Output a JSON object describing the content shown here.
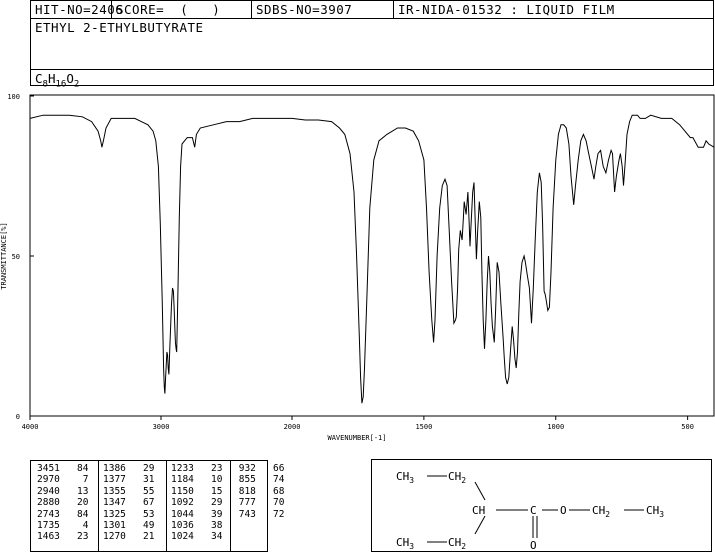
{
  "header": {
    "hit_no": "HIT-NO=2406",
    "score": "SCORE=  (   )",
    "sdbs_no": "SDBS-NO=3907",
    "ir_info": "IR-NIDA-01532 : LIQUID FILM",
    "compound_name": "ETHYL 2-ETHYLBUTYRATE",
    "formula_parts": [
      "C",
      "8",
      "H",
      "16",
      "O",
      "2"
    ]
  },
  "chart_data": {
    "type": "line",
    "xlabel": "WAVENUMBER[-1]",
    "ylabel": "TRANSMITTANCE[%]",
    "xlim": [
      4000,
      400
    ],
    "ylim": [
      0,
      100
    ],
    "x_ticks": [
      4000,
      3000,
      2000,
      1500,
      1000,
      500
    ],
    "y_ticks": [
      0,
      50,
      100
    ],
    "grid": false,
    "series": [
      {
        "points": [
          [
            4000,
            93
          ],
          [
            3900,
            94
          ],
          [
            3800,
            94
          ],
          [
            3700,
            94
          ],
          [
            3600,
            93.5
          ],
          [
            3530,
            92
          ],
          [
            3480,
            89
          ],
          [
            3460,
            86
          ],
          [
            3451,
            84
          ],
          [
            3440,
            86
          ],
          [
            3420,
            90
          ],
          [
            3380,
            93
          ],
          [
            3300,
            93
          ],
          [
            3200,
            93
          ],
          [
            3150,
            92
          ],
          [
            3100,
            91
          ],
          [
            3060,
            89
          ],
          [
            3040,
            86
          ],
          [
            3020,
            78
          ],
          [
            3005,
            60
          ],
          [
            2990,
            35
          ],
          [
            2980,
            15
          ],
          [
            2975,
            9
          ],
          [
            2970,
            7
          ],
          [
            2965,
            12
          ],
          [
            2955,
            20
          ],
          [
            2950,
            19
          ],
          [
            2945,
            15
          ],
          [
            2940,
            13
          ],
          [
            2932,
            22
          ],
          [
            2920,
            35
          ],
          [
            2912,
            40
          ],
          [
            2905,
            39
          ],
          [
            2900,
            34
          ],
          [
            2895,
            28
          ],
          [
            2890,
            23
          ],
          [
            2885,
            21
          ],
          [
            2880,
            20
          ],
          [
            2870,
            40
          ],
          [
            2860,
            62
          ],
          [
            2850,
            78
          ],
          [
            2840,
            85
          ],
          [
            2800,
            87
          ],
          [
            2760,
            87
          ],
          [
            2743,
            84
          ],
          [
            2730,
            88
          ],
          [
            2700,
            90
          ],
          [
            2600,
            91
          ],
          [
            2500,
            92
          ],
          [
            2400,
            92
          ],
          [
            2300,
            93
          ],
          [
            2200,
            93
          ],
          [
            2100,
            93
          ],
          [
            2000,
            93
          ],
          [
            1950,
            92.5
          ],
          [
            1900,
            92.5
          ],
          [
            1850,
            92
          ],
          [
            1820,
            90
          ],
          [
            1800,
            88
          ],
          [
            1780,
            82
          ],
          [
            1765,
            70
          ],
          [
            1755,
            50
          ],
          [
            1745,
            25
          ],
          [
            1740,
            12
          ],
          [
            1735,
            4
          ],
          [
            1730,
            6
          ],
          [
            1725,
            15
          ],
          [
            1715,
            40
          ],
          [
            1705,
            65
          ],
          [
            1690,
            80
          ],
          [
            1670,
            86
          ],
          [
            1640,
            88
          ],
          [
            1600,
            90
          ],
          [
            1570,
            90
          ],
          [
            1540,
            89
          ],
          [
            1520,
            86
          ],
          [
            1500,
            80
          ],
          [
            1490,
            65
          ],
          [
            1480,
            45
          ],
          [
            1470,
            30
          ],
          [
            1463,
            23
          ],
          [
            1458,
            30
          ],
          [
            1450,
            50
          ],
          [
            1440,
            65
          ],
          [
            1430,
            72
          ],
          [
            1420,
            74
          ],
          [
            1412,
            72
          ],
          [
            1405,
            60
          ],
          [
            1395,
            42
          ],
          [
            1386,
            29
          ],
          [
            1380,
            30
          ],
          [
            1377,
            31
          ],
          [
            1372,
            40
          ],
          [
            1368,
            52
          ],
          [
            1362,
            58
          ],
          [
            1355,
            55
          ],
          [
            1350,
            62
          ],
          [
            1347,
            67
          ],
          [
            1340,
            63
          ],
          [
            1333,
            70
          ],
          [
            1328,
            60
          ],
          [
            1325,
            53
          ],
          [
            1320,
            62
          ],
          [
            1315,
            70
          ],
          [
            1310,
            73
          ],
          [
            1305,
            60
          ],
          [
            1301,
            49
          ],
          [
            1296,
            58
          ],
          [
            1290,
            67
          ],
          [
            1284,
            62
          ],
          [
            1280,
            45
          ],
          [
            1275,
            30
          ],
          [
            1270,
            21
          ],
          [
            1265,
            30
          ],
          [
            1260,
            42
          ],
          [
            1255,
            50
          ],
          [
            1250,
            45
          ],
          [
            1245,
            35
          ],
          [
            1240,
            28
          ],
          [
            1233,
            23
          ],
          [
            1228,
            33
          ],
          [
            1222,
            48
          ],
          [
            1215,
            45
          ],
          [
            1208,
            35
          ],
          [
            1200,
            25
          ],
          [
            1195,
            18
          ],
          [
            1190,
            12
          ],
          [
            1184,
            10
          ],
          [
            1178,
            12
          ],
          [
            1172,
            20
          ],
          [
            1165,
            28
          ],
          [
            1160,
            24
          ],
          [
            1155,
            18
          ],
          [
            1150,
            15
          ],
          [
            1145,
            20
          ],
          [
            1140,
            32
          ],
          [
            1135,
            42
          ],
          [
            1128,
            48
          ],
          [
            1120,
            50
          ],
          [
            1115,
            48
          ],
          [
            1108,
            44
          ],
          [
            1100,
            40
          ],
          [
            1092,
            29
          ],
          [
            1085,
            40
          ],
          [
            1078,
            55
          ],
          [
            1070,
            70
          ],
          [
            1062,
            76
          ],
          [
            1055,
            73
          ],
          [
            1050,
            60
          ],
          [
            1044,
            39
          ],
          [
            1040,
            38
          ],
          [
            1036,
            36
          ],
          [
            1030,
            33
          ],
          [
            1024,
            34
          ],
          [
            1018,
            45
          ],
          [
            1010,
            65
          ],
          [
            1000,
            80
          ],
          [
            990,
            88
          ],
          [
            980,
            91
          ],
          [
            970,
            91
          ],
          [
            960,
            90
          ],
          [
            950,
            85
          ],
          [
            942,
            75
          ],
          [
            932,
            66
          ],
          [
            925,
            72
          ],
          [
            915,
            80
          ],
          [
            905,
            86
          ],
          [
            895,
            88
          ],
          [
            885,
            86
          ],
          [
            875,
            82
          ],
          [
            865,
            78
          ],
          [
            855,
            74
          ],
          [
            848,
            78
          ],
          [
            840,
            82
          ],
          [
            830,
            83
          ],
          [
            820,
            78
          ],
          [
            810,
            76
          ],
          [
            800,
            80
          ],
          [
            790,
            83
          ],
          [
            785,
            82
          ],
          [
            777,
            70
          ],
          [
            770,
            75
          ],
          [
            760,
            80
          ],
          [
            755,
            82
          ],
          [
            748,
            78
          ],
          [
            743,
            72
          ],
          [
            738,
            78
          ],
          [
            730,
            88
          ],
          [
            720,
            92
          ],
          [
            710,
            94
          ],
          [
            700,
            94
          ],
          [
            690,
            94
          ],
          [
            680,
            93
          ],
          [
            660,
            93
          ],
          [
            640,
            94
          ],
          [
            600,
            93
          ],
          [
            560,
            93
          ],
          [
            530,
            91
          ],
          [
            510,
            89
          ],
          [
            490,
            87
          ],
          [
            480,
            87
          ],
          [
            460,
            84
          ],
          [
            440,
            84
          ],
          [
            430,
            86
          ],
          [
            420,
            85
          ],
          [
            400,
            84
          ]
        ]
      }
    ]
  },
  "peak_table": {
    "columns": [
      [
        [
          "3451",
          "84"
        ],
        [
          "2970",
          "7"
        ],
        [
          "2940",
          "13"
        ],
        [
          "2880",
          "20"
        ],
        [
          "2743",
          "84"
        ],
        [
          "1735",
          "4"
        ],
        [
          "1463",
          "23"
        ]
      ],
      [
        [
          "1386",
          "29"
        ],
        [
          "1377",
          "31"
        ],
        [
          "1355",
          "55"
        ],
        [
          "1347",
          "67"
        ],
        [
          "1325",
          "53"
        ],
        [
          "1301",
          "49"
        ],
        [
          "1270",
          "21"
        ]
      ],
      [
        [
          "1233",
          "23"
        ],
        [
          "1184",
          "10"
        ],
        [
          "1150",
          "15"
        ],
        [
          "1092",
          "29"
        ],
        [
          "1044",
          "39"
        ],
        [
          "1036",
          "38"
        ],
        [
          "1024",
          "34"
        ]
      ],
      [
        [
          "932",
          "66"
        ],
        [
          "855",
          "74"
        ],
        [
          "818",
          "68"
        ],
        [
          "777",
          "70"
        ],
        [
          "743",
          "72"
        ]
      ]
    ]
  },
  "structure": {
    "ch3_top": "CH3",
    "ch2_top": "CH2",
    "ch": "CH",
    "c": "C",
    "o_double": "O",
    "o_ester": "O",
    "ch2_ester": "CH2",
    "ch3_ester": "CH3",
    "ch3_bottom": "CH3",
    "ch2_bottom": "CH2"
  }
}
